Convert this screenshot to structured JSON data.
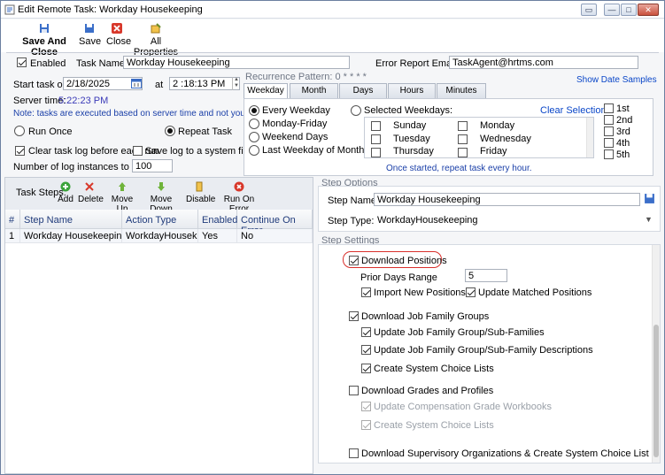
{
  "window": {
    "title": "Edit Remote Task: Workday Housekeeping",
    "controls": [
      "▭",
      "—",
      "□",
      "✕"
    ]
  },
  "toolbar": {
    "save_close": "Save And Close",
    "save": "Save",
    "close": "Close",
    "all_properties": "All Properties"
  },
  "general": {
    "enabled_label": "Enabled",
    "enabled": true,
    "task_name_label": "Task Name:",
    "task_name": "Workday Housekeeping",
    "error_email_label": "Error Report Email:",
    "error_email": "TaskAgent@hrtms.com",
    "start_label": "Start task on",
    "start_date": "2/18/2025",
    "at_label": "at",
    "start_time": "2 :18:13 PM",
    "server_time_label": "Server time:",
    "server_time": "5:22:23 PM",
    "note": "Note: tasks are executed based on server time and not your local time!",
    "run_once": "Run Once",
    "repeat_task": "Repeat Task",
    "clear_log": "Clear task log before each run",
    "save_log": "Save log to a system file",
    "log_instances_label": "Number of log instances to keep:",
    "log_instances": "100"
  },
  "recurrence": {
    "label": "Recurrence Pattern: 0 * * * *",
    "show_samples": "Show Date Samples",
    "tabs": [
      "Weekday",
      "Month",
      "Days",
      "Hours",
      "Minutes"
    ],
    "options": [
      "Every Weekday",
      "Monday-Friday",
      "Weekend Days",
      "Last Weekday of Month"
    ],
    "selected_weekdays": "Selected Weekdays:",
    "clear_selection": "Clear Selection",
    "days_col1": [
      "Sunday",
      "Tuesday",
      "Thursday"
    ],
    "days_col2": [
      "Monday",
      "Wednesday",
      "Friday"
    ],
    "weeks": [
      "1st",
      "2nd",
      "3rd",
      "4th",
      "5th"
    ],
    "summary": "Once started, repeat task every hour."
  },
  "steps": {
    "label": "Task Steps:",
    "add": "Add",
    "delete": "Delete",
    "move_up": "Move Up",
    "move_down": "Move Down",
    "disable": "Disable",
    "run_on_error": "Run On Error",
    "columns": [
      "#",
      "Step Name",
      "Action Type",
      "Enabled",
      "Continue On Error"
    ],
    "rows": [
      {
        "num": "1",
        "name": "Workday Housekeeping",
        "action": "WorkdayHousekeeping",
        "enabled": "Yes",
        "continue": "No"
      }
    ]
  },
  "step_options": {
    "section": "Step Options",
    "name_label": "Step Name:",
    "name": "Workday Housekeeping",
    "type_label": "Step Type:",
    "type": "WorkdayHousekeeping"
  },
  "step_settings": {
    "section": "Step Settings",
    "download_positions": "Download Positions",
    "prior_days_label": "Prior Days Range",
    "prior_days": "5",
    "import_new": "Import New Positions",
    "update_matched": "Update Matched Positions",
    "download_job_family": "Download Job Family Groups",
    "update_jf": "Update Job Family Group/Sub-Families",
    "update_jf_desc": "Update Job Family Group/Sub-Family Descriptions",
    "create_choice": "Create System Choice Lists",
    "download_grades": "Download Grades and Profiles",
    "update_comp": "Update Compensation Grade Workbooks",
    "create_choice2": "Create System Choice Lists",
    "download_sup": "Download Supervisory Organizations & Create System Choice List"
  },
  "colors": {
    "accent": "#1a3fa8",
    "highlight": "#d9302c"
  }
}
